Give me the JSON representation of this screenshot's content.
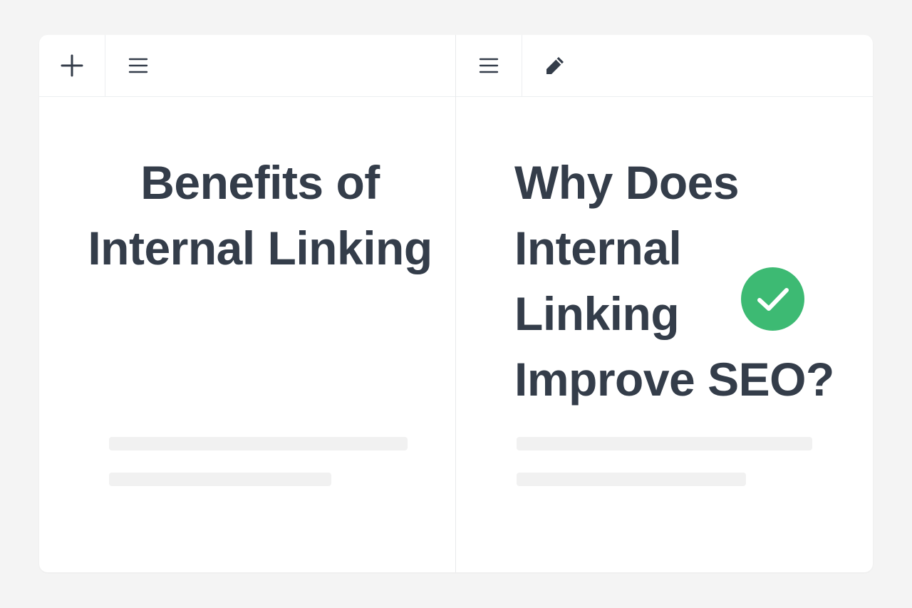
{
  "toolbar": {
    "left_pane": {
      "add_icon": "plus-icon",
      "menu_icon": "hamburger-icon"
    },
    "right_pane": {
      "menu_icon": "hamburger-icon",
      "edit_icon": "pencil-icon"
    }
  },
  "left_pane": {
    "title": "Benefits of Internal Linking"
  },
  "right_pane": {
    "title": "Why Does Internal Linking Improve SEO?",
    "status_icon": "check-circle-icon"
  },
  "colors": {
    "title_text": "#343d4a",
    "check_badge": "#3dba73",
    "skeleton": "#f1f1f1",
    "background": "#f4f4f4"
  }
}
